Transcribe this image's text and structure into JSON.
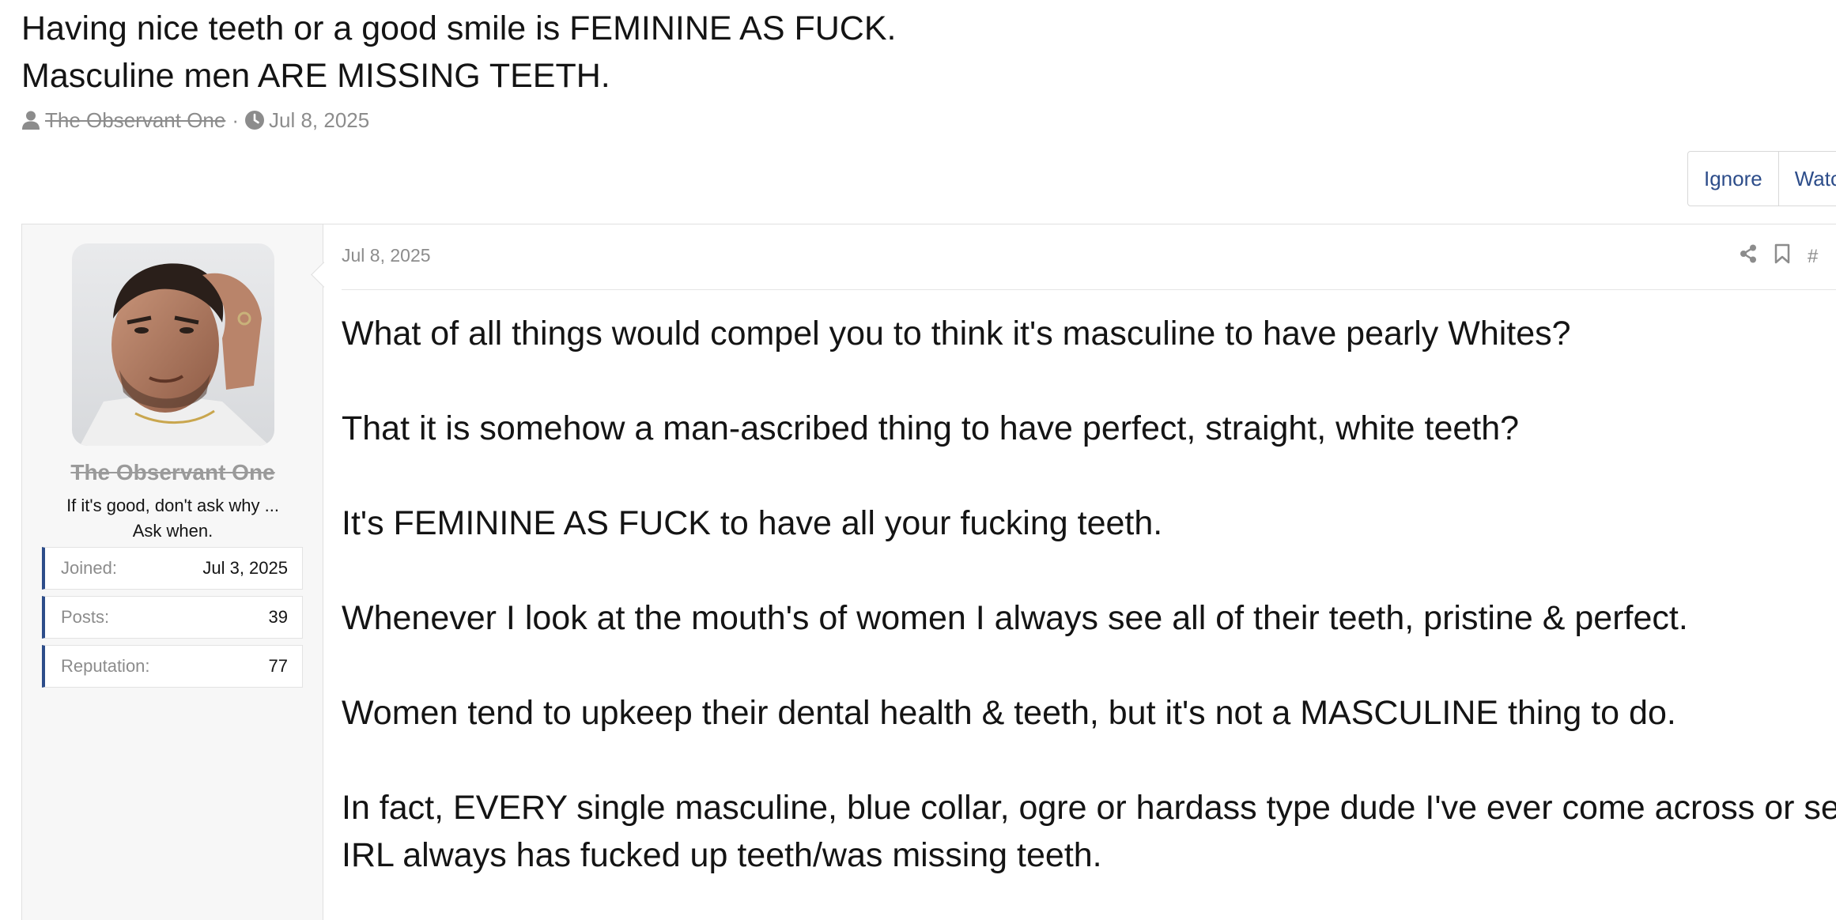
{
  "thread": {
    "title_line1": "Having nice teeth or a good smile is FEMININE AS FUCK.",
    "title_line2": "Masculine men ARE MISSING TEETH.",
    "author": "The Observant One",
    "separator": "·",
    "date": "Jul 8, 2025",
    "icons": {
      "author": "user-icon",
      "date": "clock-icon"
    }
  },
  "actions": {
    "ignore_label": "Ignore",
    "watch_label": "Watc"
  },
  "post": {
    "date": "Jul 8, 2025",
    "tools": {
      "share": "share-icon",
      "bookmark": "bookmark-icon",
      "permalink": "#"
    },
    "paragraphs": [
      "What of all things would compel you to think it's masculine to have pearly Whites?",
      "That it is somehow a man-ascribed thing to have perfect, straight, white teeth?",
      "It's FEMININE AS FUCK to have all your fucking teeth.",
      "Whenever I look at the mouth's of women I always see all of their teeth, pristine & perfect.",
      "Women tend to upkeep their dental health & teeth, but it's not a MASCULINE thing to do.",
      "In fact, EVERY single masculine, blue collar, ogre or hardass type dude I've ever come across or seen IRL always has fucked up teeth/was missing teeth."
    ]
  },
  "user": {
    "name": "The Observant One",
    "title_line1": "If it's good, don't ask why ...",
    "title_line2": "Ask when.",
    "stats": [
      {
        "key": "Joined:",
        "value": "Jul 3, 2025"
      },
      {
        "key": "Posts:",
        "value": "39"
      },
      {
        "key": "Reputation:",
        "value": "77"
      }
    ]
  },
  "colors": {
    "accent": "#2d4d8a",
    "muted": "#8c8c8c",
    "text": "#141414",
    "sidebar_bg": "#f7f7f7",
    "border": "#e0e0e0"
  }
}
